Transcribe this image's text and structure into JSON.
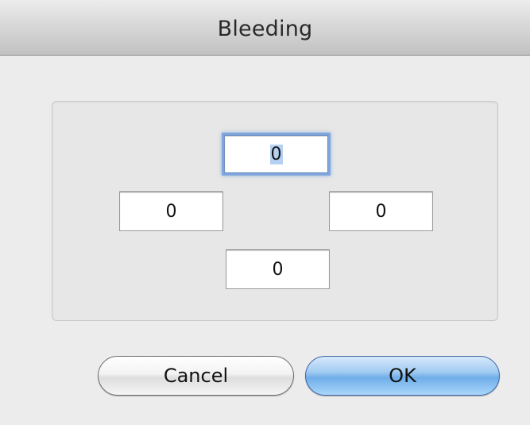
{
  "dialog": {
    "title": "Bleeding"
  },
  "bleed_fields": {
    "top": "0",
    "left": "0",
    "right": "0",
    "bottom": "0"
  },
  "buttons": {
    "cancel_label": "Cancel",
    "ok_label": "OK"
  },
  "colors": {
    "window_bg": "#ececec",
    "focus_ring": "#7ea6dd",
    "default_button": "#6faee9"
  }
}
